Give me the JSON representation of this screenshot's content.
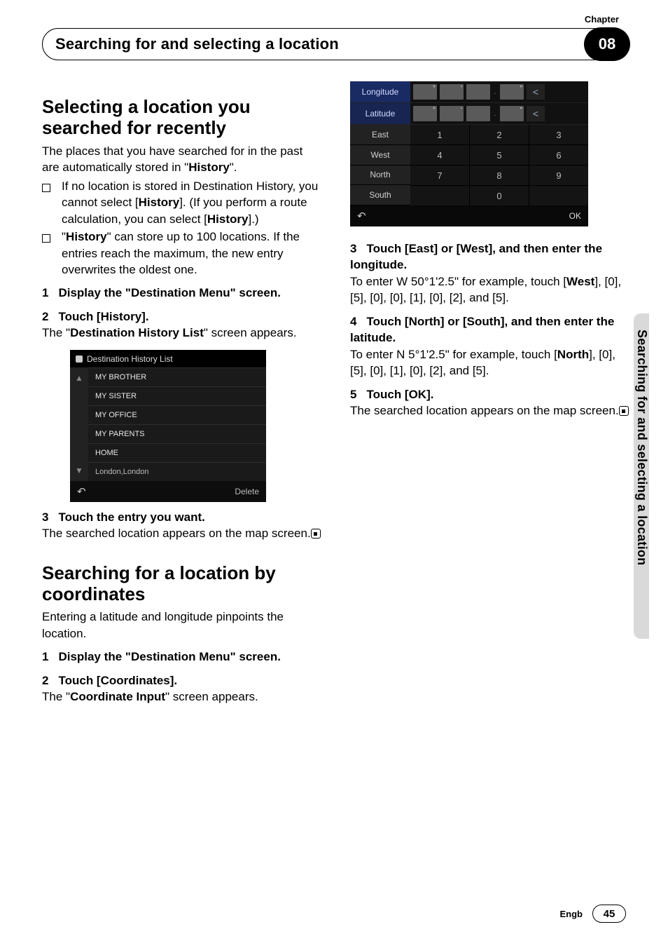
{
  "header": {
    "chapter_label": "Chapter",
    "title": "Searching for and selecting a location",
    "chapter_num": "08"
  },
  "side_tab": "Searching for and selecting a location",
  "footer": {
    "lang": "Engb",
    "page": "45"
  },
  "left": {
    "section1_title": "Selecting a location you searched for recently",
    "intro_a": "The places that you have searched for in the past are automatically stored in \"",
    "intro_b_bold": "History",
    "intro_c": "\".",
    "bullet1_a": "If no location is stored in Destination History, you cannot select [",
    "bullet1_b_bold": "History",
    "bullet1_c": "]. (If you perform a route calculation, you can select [",
    "bullet1_d_bold": "History",
    "bullet1_e": "].)",
    "bullet2_a": "\"",
    "bullet2_b_bold": "History",
    "bullet2_c": "\" can store up to 100 locations. If the entries reach the maximum, the new entry overwrites the oldest one.",
    "step1": {
      "num": "1",
      "text": "Display the \"Destination Menu\" screen."
    },
    "step2": {
      "num": "2",
      "text": "Touch [History]."
    },
    "after2_a": "The \"",
    "after2_b_bold": "Destination History List",
    "after2_c": "\" screen appears.",
    "hist_shot": {
      "title": "Destination History List",
      "items": [
        "MY BROTHER",
        "MY SISTER",
        "MY OFFICE",
        "MY PARENTS",
        "HOME",
        "London,London"
      ],
      "delete": "Delete"
    },
    "step3": {
      "num": "3",
      "text": "Touch the entry you want."
    },
    "after3": "The searched location appears on the map screen.",
    "section2_title": "Searching for a location by coordinates",
    "section2_intro": "Entering a latitude and longitude pinpoints the location.",
    "s2_step1": {
      "num": "1",
      "text": "Display the \"Destination Menu\" screen."
    },
    "s2_step2": {
      "num": "2",
      "text": "Touch [Coordinates]."
    },
    "s2_after2_a": "The \"",
    "s2_after2_b_bold": "Coordinate Input",
    "s2_after2_c": "\" screen appears."
  },
  "right": {
    "coord_shot": {
      "longitude": "Longitude",
      "latitude": "Latitude",
      "dirs": [
        "East",
        "West",
        "North",
        "South"
      ],
      "keys": [
        "1",
        "2",
        "3",
        "4",
        "5",
        "6",
        "7",
        "8",
        "9",
        "",
        "0",
        ""
      ],
      "ok": "OK",
      "field_syms": [
        "°",
        "'",
        "",
        "\"",
        ""
      ]
    },
    "step3": {
      "num": "3",
      "text": "Touch [East] or [West], and then enter the longitude."
    },
    "after3_a": "To enter W 50°1'2.5\" for example, touch [",
    "after3_b_bold": "West",
    "after3_c": "], [0], [5], [0], [0], [1], [0], [2], and [5].",
    "step4": {
      "num": "4",
      "text": "Touch [North] or [South], and then enter the latitude."
    },
    "after4_a": "To enter N 5°1'2.5\" for example, touch [",
    "after4_b_bold": "North",
    "after4_c": "], [0], [5], [0], [1], [0], [2], and [5].",
    "step5": {
      "num": "5",
      "text": "Touch [OK]."
    },
    "after5": "The searched location appears on the map screen."
  }
}
